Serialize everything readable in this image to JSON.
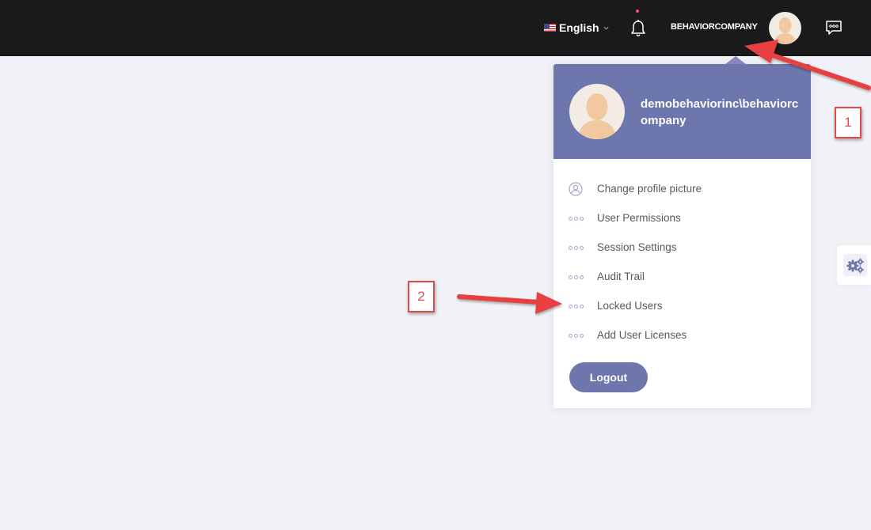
{
  "topbar": {
    "language": "English",
    "username": "BEHAVIORCOMPANY",
    "icons": {
      "flag": "us-flag-icon",
      "chevron": "chevron-down-icon",
      "bell": "bell-icon",
      "chat": "chat-icon"
    },
    "notification_color": "#f4516c"
  },
  "dropdown": {
    "account_name": "demobehaviorinc\\behaviorcompany",
    "header_color": "#6e76ae",
    "items": [
      {
        "label": "Change profile picture",
        "icon": "profile-picture-icon"
      },
      {
        "label": "User Permissions",
        "icon": "dots-icon"
      },
      {
        "label": "Session Settings",
        "icon": "dots-icon"
      },
      {
        "label": "Audit Trail",
        "icon": "dots-icon"
      },
      {
        "label": "Locked Users",
        "icon": "dots-icon"
      },
      {
        "label": "Add User Licenses",
        "icon": "dots-icon"
      }
    ],
    "logout_label": "Logout"
  },
  "side_panel": {
    "icon": "gears-icon"
  },
  "annotations": {
    "badge_1": "1",
    "badge_2": "2",
    "color": "#e24a4a"
  }
}
